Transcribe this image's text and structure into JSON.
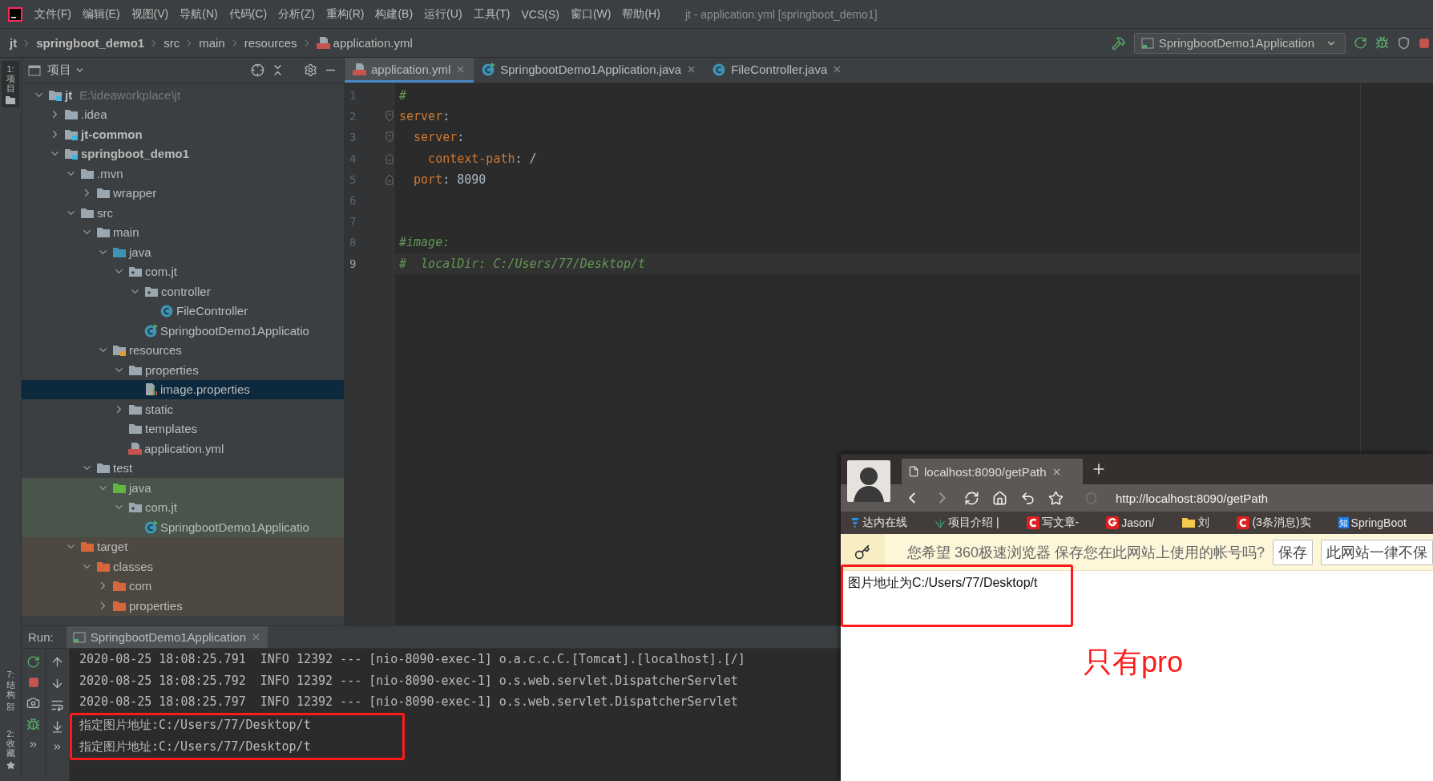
{
  "menu_bar": {
    "items": [
      "文件(F)",
      "编辑(E)",
      "视图(V)",
      "导航(N)",
      "代码(C)",
      "分析(Z)",
      "重构(R)",
      "构建(B)",
      "运行(U)",
      "工具(T)",
      "VCS(S)",
      "窗口(W)",
      "帮助(H)"
    ],
    "title": "jt - application.yml [springboot_demo1]"
  },
  "breadcrumbs": [
    {
      "label": "jt",
      "bold": true,
      "kind": "plain"
    },
    {
      "label": "springboot_demo1",
      "bold": true,
      "kind": "plain"
    },
    {
      "label": "src",
      "bold": false,
      "kind": "plain"
    },
    {
      "label": "main",
      "bold": false,
      "kind": "plain"
    },
    {
      "label": "resources",
      "bold": false,
      "kind": "plain"
    },
    {
      "label": "application.yml",
      "bold": false,
      "kind": "yml"
    }
  ],
  "run_configuration": "SpringbootDemo1Application",
  "tool_stripe": {
    "top": [
      {
        "label": "1: 项目",
        "selected": true
      }
    ],
    "bottom": [
      {
        "label": "7: 结构",
        "selected": false
      },
      {
        "label": "2: 收藏",
        "selected": false
      }
    ]
  },
  "project_panel": {
    "title": "项目",
    "tree": [
      {
        "label": "jt",
        "path": "E:\\ideaworkplace\\jt",
        "kind": "module",
        "expanded": true,
        "selected": false,
        "children": [
          {
            "label": ".idea",
            "kind": "folder",
            "expanded": false,
            "selected": false
          },
          {
            "label": "jt-common",
            "kind": "module",
            "expanded": false,
            "selected": false
          },
          {
            "label": "springboot_demo1",
            "kind": "module",
            "expanded": true,
            "selected": false,
            "children": [
              {
                "label": ".mvn",
                "kind": "folder",
                "expanded": true,
                "selected": false,
                "children": [
                  {
                    "label": "wrapper",
                    "kind": "folder",
                    "expanded": false,
                    "selected": false
                  }
                ]
              },
              {
                "label": "src",
                "kind": "folder",
                "expanded": true,
                "selected": false,
                "children": [
                  {
                    "label": "main",
                    "kind": "folder",
                    "expanded": true,
                    "selected": false,
                    "children": [
                      {
                        "label": "java",
                        "kind": "source",
                        "expanded": true,
                        "selected": false,
                        "children": [
                          {
                            "label": "com.jt",
                            "kind": "package",
                            "expanded": true,
                            "selected": false,
                            "children": [
                              {
                                "label": "controller",
                                "kind": "package",
                                "expanded": true,
                                "selected": false,
                                "children": [
                                  {
                                    "label": "FileController",
                                    "kind": "class",
                                    "selected": false
                                  }
                                ]
                              },
                              {
                                "label": "SpringbootDemo1Applicatio",
                                "kind": "runnable",
                                "selected": false
                              }
                            ]
                          }
                        ]
                      },
                      {
                        "label": "resources",
                        "kind": "resources",
                        "expanded": true,
                        "selected": false,
                        "children": [
                          {
                            "label": "properties",
                            "kind": "folder",
                            "expanded": true,
                            "selected": false,
                            "children": [
                              {
                                "label": "image.properties",
                                "kind": "properties",
                                "selected": true
                              }
                            ]
                          },
                          {
                            "label": "static",
                            "kind": "folder",
                            "expanded": false,
                            "selected": false
                          },
                          {
                            "label": "templates",
                            "kind": "folder",
                            "selected": false
                          },
                          {
                            "label": "application.yml",
                            "kind": "yml",
                            "selected": false
                          }
                        ]
                      }
                    ]
                  },
                  {
                    "label": "test",
                    "kind": "folder",
                    "expanded": true,
                    "selected": false,
                    "children": [
                      {
                        "label": "java",
                        "kind": "test",
                        "expanded": true,
                        "selected": false,
                        "children": [
                          {
                            "label": "com.jt",
                            "kind": "package",
                            "expanded": true,
                            "selected": false,
                            "children": [
                              {
                                "label": "SpringbootDemo1Applicatio",
                                "kind": "runnable",
                                "selected": false
                              }
                            ]
                          }
                        ]
                      }
                    ]
                  }
                ]
              },
              {
                "label": "target",
                "kind": "excluded",
                "expanded": true,
                "selected": false,
                "children": [
                  {
                    "label": "classes",
                    "kind": "excluded",
                    "expanded": true,
                    "selected": false,
                    "children": [
                      {
                        "label": "com",
                        "kind": "excluded",
                        "expanded": false,
                        "selected": false
                      },
                      {
                        "label": "properties",
                        "kind": "excluded",
                        "expanded": false,
                        "selected": false
                      }
                    ]
                  }
                ]
              }
            ]
          }
        ]
      }
    ]
  },
  "editor": {
    "tabs": [
      {
        "label": "application.yml",
        "kind": "yml",
        "selected": true
      },
      {
        "label": "SpringbootDemo1Application.java",
        "kind": "runnable",
        "selected": false
      },
      {
        "label": "FileController.java",
        "kind": "class",
        "selected": false
      }
    ],
    "lines": [
      {
        "number": "1",
        "current": false,
        "kind": "plain",
        "segments": [
          {
            "kind": "comment",
            "text": "#"
          }
        ]
      },
      {
        "number": "2",
        "current": false,
        "kind": "foldstart",
        "segments": [
          {
            "kind": "key",
            "text": "server"
          },
          {
            "kind": "punct",
            "text": ":"
          }
        ]
      },
      {
        "number": "3",
        "current": false,
        "kind": "foldstart",
        "segments": [
          {
            "kind": "key",
            "text": "  server"
          },
          {
            "kind": "punct",
            "text": ":"
          }
        ]
      },
      {
        "number": "4",
        "current": false,
        "kind": "foldend",
        "segments": [
          {
            "kind": "key",
            "text": "    context-path"
          },
          {
            "kind": "punct",
            "text": ": "
          },
          {
            "kind": "value",
            "text": "/"
          }
        ]
      },
      {
        "number": "5",
        "current": false,
        "kind": "foldend",
        "segments": [
          {
            "kind": "key",
            "text": "  port"
          },
          {
            "kind": "punct",
            "text": ": "
          },
          {
            "kind": "value",
            "text": "8090"
          }
        ]
      },
      {
        "number": "6",
        "current": false,
        "kind": "plain"
      },
      {
        "number": "7",
        "current": false,
        "kind": "plain"
      },
      {
        "number": "8",
        "current": false,
        "kind": "plain",
        "segments": [
          {
            "kind": "comment",
            "text": "#image:"
          }
        ]
      },
      {
        "number": "9",
        "current": true,
        "kind": "plain",
        "segments": [
          {
            "kind": "comment",
            "text": "#  localDir: C:/Users/77/Desktop/t"
          }
        ]
      }
    ]
  },
  "run_panel": {
    "label": "Run:",
    "tab": "SpringbootDemo1Application",
    "lines": [
      {
        "text": "2020-08-25 18:08:25.791  INFO 12392 --- [nio-8090-exec-1] o.a.c.c.C.[Tomcat].[localhost].[/]",
        "boxed": false
      },
      {
        "text": "2020-08-25 18:08:25.792  INFO 12392 --- [nio-8090-exec-1] o.s.web.servlet.DispatcherServlet",
        "boxed": false
      },
      {
        "text": "2020-08-25 18:08:25.797  INFO 12392 --- [nio-8090-exec-1] o.s.web.servlet.DispatcherServlet",
        "boxed": false
      },
      {
        "text": "指定图片地址:C:/Users/77/Desktop/t",
        "boxed": true
      },
      {
        "text": "指定图片地址:C:/Users/77/Desktop/t",
        "boxed": true
      }
    ]
  },
  "browser": {
    "tab": "localhost:8090/getPath",
    "url": "http://localhost:8090/getPath",
    "bookmarks": [
      {
        "label": "达内在线",
        "kind": "flag"
      },
      {
        "label": "项目介绍 |",
        "kind": "plant"
      },
      {
        "label": "写文章-",
        "kind": "csdn"
      },
      {
        "label": "Jason/",
        "kind": "g"
      },
      {
        "label": "刘",
        "kind": "folder"
      },
      {
        "label": "(3条消息)实",
        "kind": "csdn"
      },
      {
        "label": "SpringBoot",
        "kind": "badge",
        "badge": "知"
      }
    ],
    "save_prompt": {
      "text": "您希望 360极速浏览器 保存您在此网站上使用的帐号吗?",
      "buttons": [
        "保存",
        "此网站一律不保"
      ]
    },
    "page": {
      "text": "图片地址为C:/Users/77/Desktop/t",
      "boxed": true,
      "annotation": "只有pro"
    }
  }
}
